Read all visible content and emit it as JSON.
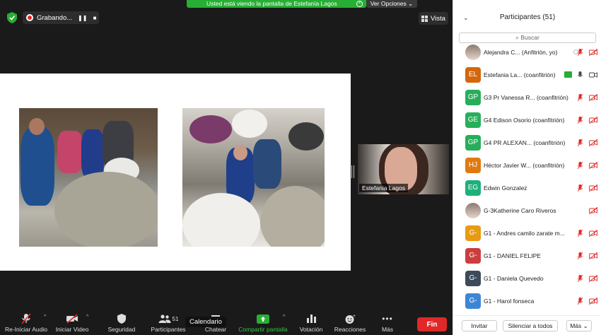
{
  "window": {
    "recording_label": "Grabando...",
    "share_banner": "Usted está viendo la pantalla de Estefanía Lagos",
    "options_label": "Ver Opciones",
    "view_label": "Vista",
    "video_name": "Estefania Lagos",
    "tooltip": "Calendario"
  },
  "toolbar": {
    "items": [
      {
        "label": "Re-Iniciar Audio",
        "icon": "mic-muted-icon"
      },
      {
        "label": "Iniciar Video",
        "icon": "video-off-icon"
      },
      {
        "label": "Seguridad",
        "icon": "shield-icon"
      },
      {
        "label": "Participantes",
        "icon": "participants-icon",
        "count": "51"
      },
      {
        "label": "Chatear",
        "icon": "chat-icon"
      },
      {
        "label": "Compartir pantalla",
        "icon": "share-screen-icon"
      },
      {
        "label": "Votación",
        "icon": "poll-icon"
      },
      {
        "label": "Reacciones",
        "icon": "reaction-icon"
      },
      {
        "label": "Más",
        "icon": "more-icon"
      }
    ],
    "end_label": "Fin",
    "accent": "#27ae34",
    "end_color": "#e02828"
  },
  "panel": {
    "title": "Participantes (51)",
    "search_placeholder": "Buscar",
    "participants": [
      {
        "initials": "",
        "name": "Alejandra C...  (Anfitrión, yo)",
        "color": "photo"
      },
      {
        "initials": "EL",
        "name": "Estefania La...  (coanfitrión)",
        "color": "#d4660e"
      },
      {
        "initials": "GP",
        "name": "G3 Pr Vanessa R...  (coanfitrión)",
        "color": "#27ae5a"
      },
      {
        "initials": "GE",
        "name": "G4 Edison Osorio  (coanfitrión)",
        "color": "#27ae5a"
      },
      {
        "initials": "GP",
        "name": "G4 PR ALEXAN...   (coanfitrión)",
        "color": "#27ae5a"
      },
      {
        "initials": "HJ",
        "name": "Héctor Javier W...  (coanfitrión)",
        "color": "#e07a10"
      },
      {
        "initials": "EG",
        "name": "Edwin Gonzalez",
        "color": "#1fb07a"
      },
      {
        "initials": "",
        "name": "G-3Katherine Caro Riveros",
        "color": "photo"
      },
      {
        "initials": "G-",
        "name": "G1 - Andres camilo zarate m...",
        "color": "#e89a12"
      },
      {
        "initials": "G-",
        "name": "G1 - DANIEL FELIPE",
        "color": "#cc3d3d"
      },
      {
        "initials": "G-",
        "name": "G1 - Daniela Quevedo",
        "color": "#3c4a59"
      },
      {
        "initials": "G-",
        "name": "G1 - Harol fonseca",
        "color": "#3d86d6"
      }
    ],
    "invite_label": "Invitar",
    "mute_all_label": "Silenciar a todos",
    "more_label": "Más"
  }
}
